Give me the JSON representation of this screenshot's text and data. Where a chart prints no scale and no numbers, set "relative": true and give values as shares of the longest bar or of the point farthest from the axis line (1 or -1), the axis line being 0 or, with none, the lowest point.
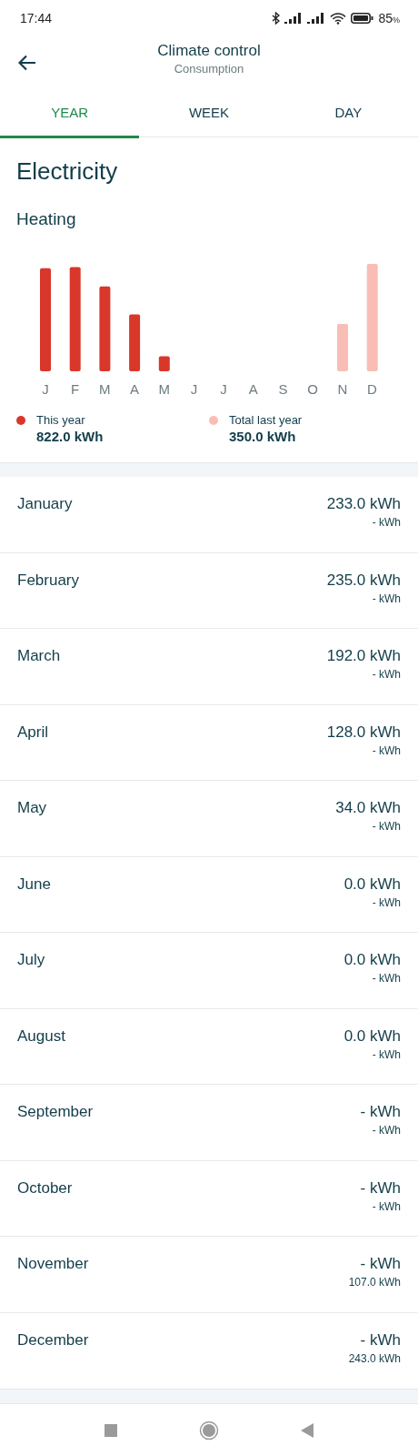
{
  "status_bar": {
    "time": "17:44",
    "battery": "85",
    "battery_unit": "%"
  },
  "header": {
    "title": "Climate control",
    "subtitle": "Consumption"
  },
  "tabs": [
    {
      "label": "YEAR",
      "selected": true
    },
    {
      "label": "WEEK",
      "selected": false
    },
    {
      "label": "DAY",
      "selected": false
    }
  ],
  "section_title": "Electricity",
  "chart_title": "Heating",
  "chart_data": {
    "type": "bar",
    "relative": true,
    "categories": [
      "J",
      "F",
      "M",
      "A",
      "M",
      "J",
      "J",
      "A",
      "S",
      "O",
      "N",
      "D"
    ],
    "series": [
      {
        "name": "This year",
        "color": "#d9372a",
        "values": [
          0.96,
          0.97,
          0.79,
          0.53,
          0.14,
          0,
          0,
          0,
          null,
          null,
          null,
          null
        ]
      },
      {
        "name": "Total last year",
        "color": "#f8bdb5",
        "values": [
          null,
          null,
          null,
          null,
          null,
          null,
          null,
          null,
          null,
          null,
          0.44,
          1
        ]
      }
    ]
  },
  "legend_totals": [
    "822.0 kWh",
    "350.0 kWh"
  ],
  "months": [
    {
      "name": "January",
      "value": "233.0 kWh",
      "last_year": "- kWh"
    },
    {
      "name": "February",
      "value": "235.0 kWh",
      "last_year": "- kWh"
    },
    {
      "name": "March",
      "value": "192.0 kWh",
      "last_year": "- kWh"
    },
    {
      "name": "April",
      "value": "128.0 kWh",
      "last_year": "- kWh"
    },
    {
      "name": "May",
      "value": "34.0 kWh",
      "last_year": "- kWh"
    },
    {
      "name": "June",
      "value": "0.0 kWh",
      "last_year": "- kWh"
    },
    {
      "name": "July",
      "value": "0.0 kWh",
      "last_year": "- kWh"
    },
    {
      "name": "August",
      "value": "0.0 kWh",
      "last_year": "- kWh"
    },
    {
      "name": "September",
      "value": "- kWh",
      "last_year": "- kWh"
    },
    {
      "name": "October",
      "value": "- kWh",
      "last_year": "- kWh"
    },
    {
      "name": "November",
      "value": "- kWh",
      "last_year": "107.0 kWh"
    },
    {
      "name": "December",
      "value": "- kWh",
      "last_year": "243.0 kWh"
    }
  ]
}
